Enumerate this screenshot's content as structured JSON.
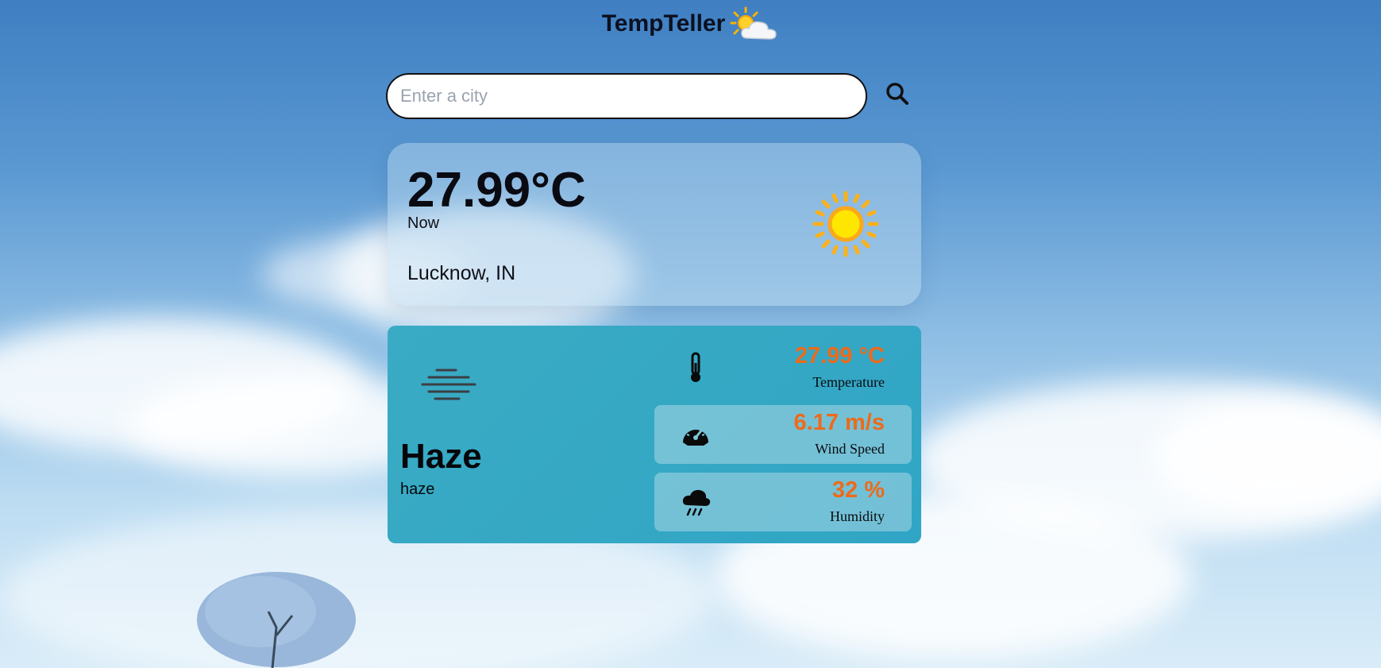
{
  "header": {
    "title": "TempTeller",
    "logo_icon": "sun-behind-cloud-icon"
  },
  "search": {
    "placeholder": "Enter a city",
    "value": "",
    "button_icon": "search-icon"
  },
  "current": {
    "temperature": "27.99°C",
    "time_label": "Now",
    "location": "Lucknow, IN",
    "icon": "sun-icon"
  },
  "details": {
    "condition_icon": "haze-icon",
    "condition_main": "Haze",
    "condition_desc": "haze",
    "stats": [
      {
        "value": "27.99 °C",
        "label": "Temperature",
        "icon": "thermometer-icon"
      },
      {
        "value": "6.17 m/s",
        "label": "Wind Speed",
        "icon": "speedometer-icon"
      },
      {
        "value": "32 %",
        "label": "Humidity",
        "icon": "rain-cloud-icon"
      }
    ]
  },
  "colors": {
    "accent": "#ee6a1a",
    "details_bg": "#33a8c5",
    "sun": "#fbb11b"
  }
}
